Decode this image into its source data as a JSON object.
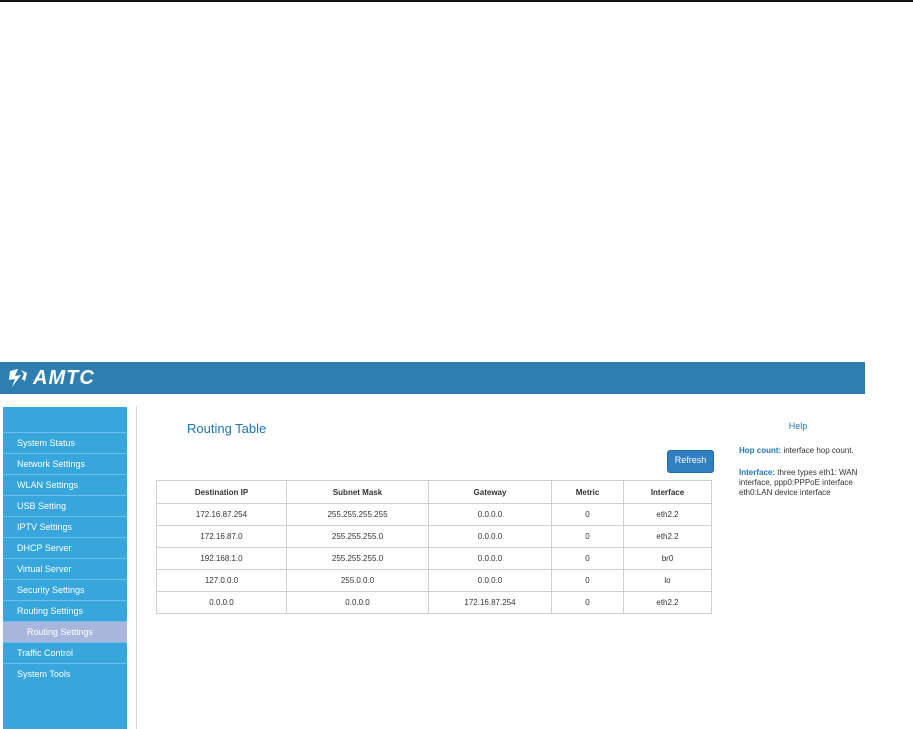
{
  "brand": {
    "name": "AMTC",
    "header_color": "#2e7eb0",
    "sidebar_color": "#36a6dc",
    "active_sub_color": "#a9b6dc"
  },
  "sidebar": {
    "items": [
      {
        "label": "System Status"
      },
      {
        "label": "Network Settings"
      },
      {
        "label": "WLAN Settings"
      },
      {
        "label": "USB Setting"
      },
      {
        "label": "IPTV Settings"
      },
      {
        "label": "DHCP Server"
      },
      {
        "label": "Virtual Server"
      },
      {
        "label": "Security Settings"
      },
      {
        "label": "Routing Settings"
      }
    ],
    "active_sub": "Routing Settings",
    "items_after": [
      {
        "label": "Traffic Control"
      },
      {
        "label": "System Tools"
      }
    ]
  },
  "main": {
    "title": "Routing Table",
    "refresh_label": "Refresh",
    "table": {
      "headers": [
        "Destination IP",
        "Subnet Mask",
        "Gateway",
        "Metric",
        "Interface"
      ],
      "rows": [
        [
          "172.16.87.254",
          "255.255.255.255",
          "0.0.0.0",
          "0",
          "eth2.2"
        ],
        [
          "172.16.87.0",
          "255.255.255.0",
          "0.0.0.0",
          "0",
          "eth2.2"
        ],
        [
          "192.168.1.0",
          "255.255.255.0",
          "0.0.0.0",
          "0",
          "br0"
        ],
        [
          "127.0.0.0",
          "255.0.0.0",
          "0.0.0.0",
          "0",
          "lo"
        ],
        [
          "0.0.0.0",
          "0.0.0.0",
          "172.16.87.254",
          "0",
          "eth2.2"
        ]
      ]
    }
  },
  "help": {
    "title": "Help",
    "hop_key": "Hop count:",
    "hop_text": " interface hop count.",
    "iface_key": "Interface:",
    "iface_text": " three types eth1: WAN interface, ppp0:PPPoE interface eth0:LAN device interface"
  }
}
